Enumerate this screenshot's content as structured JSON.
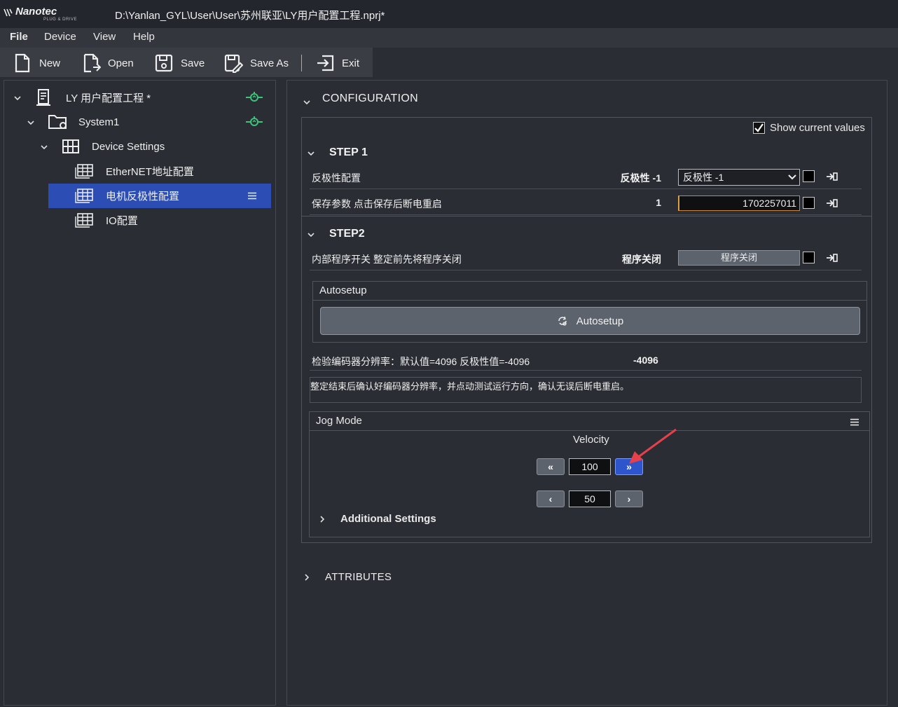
{
  "window": {
    "brand": "Nanotec",
    "brand_sub": "PLUG & DRIVE",
    "title": "D:\\Yanlan_GYL\\User\\User\\苏州联亚\\LY用户配置工程.nprj*"
  },
  "menu": [
    "File",
    "Device",
    "View",
    "Help"
  ],
  "toolbar": {
    "new": "New",
    "open": "Open",
    "save": "Save",
    "save_as": "Save As",
    "exit": "Exit"
  },
  "tree": {
    "project": "LY 用户配置工程 *",
    "system": "System1",
    "device_settings": "Device Settings",
    "items": [
      "EtherNET地址配置",
      "电机反极性配置",
      "IO配置"
    ]
  },
  "config": {
    "section_title": "CONFIGURATION",
    "show_current_values": "Show current values",
    "step1": {
      "title": "STEP 1",
      "rows": [
        {
          "label": "反极性配置",
          "value": "反极性 -1",
          "control": "反极性 -1"
        },
        {
          "label": "保存参数 点击保存后断电重启",
          "value": "1",
          "control": "1702257011"
        }
      ]
    },
    "step2": {
      "title": "STEP2",
      "row": {
        "label": "内部程序开关 整定前先将程序关闭",
        "value": "程序关闭",
        "control": "程序关闭"
      },
      "autosetup_title": "Autosetup",
      "autosetup_button": "Autosetup",
      "encoder_label": "检验编码器分辨率：默认值=4096 反极性值=-4096",
      "encoder_value": "-4096",
      "note": "整定结束后确认好编码器分辨率，并点动测试运行方向，确认无误后断电重启。"
    },
    "jog": {
      "title": "Jog Mode",
      "velocity_label": "Velocity",
      "velocity_value": "100",
      "step_value": "50",
      "fast_left": "«",
      "fast_right": "»",
      "slow_left": "‹",
      "slow_right": "›"
    },
    "additional_settings": "Additional Settings"
  },
  "attributes_title": "ATTRIBUTES",
  "colors": {
    "background": "#2a2d34",
    "selection": "#2c4db3",
    "online_indicator": "#3cc47a",
    "active_button": "#2e55cc",
    "annotation_arrow": "#e8404a"
  }
}
